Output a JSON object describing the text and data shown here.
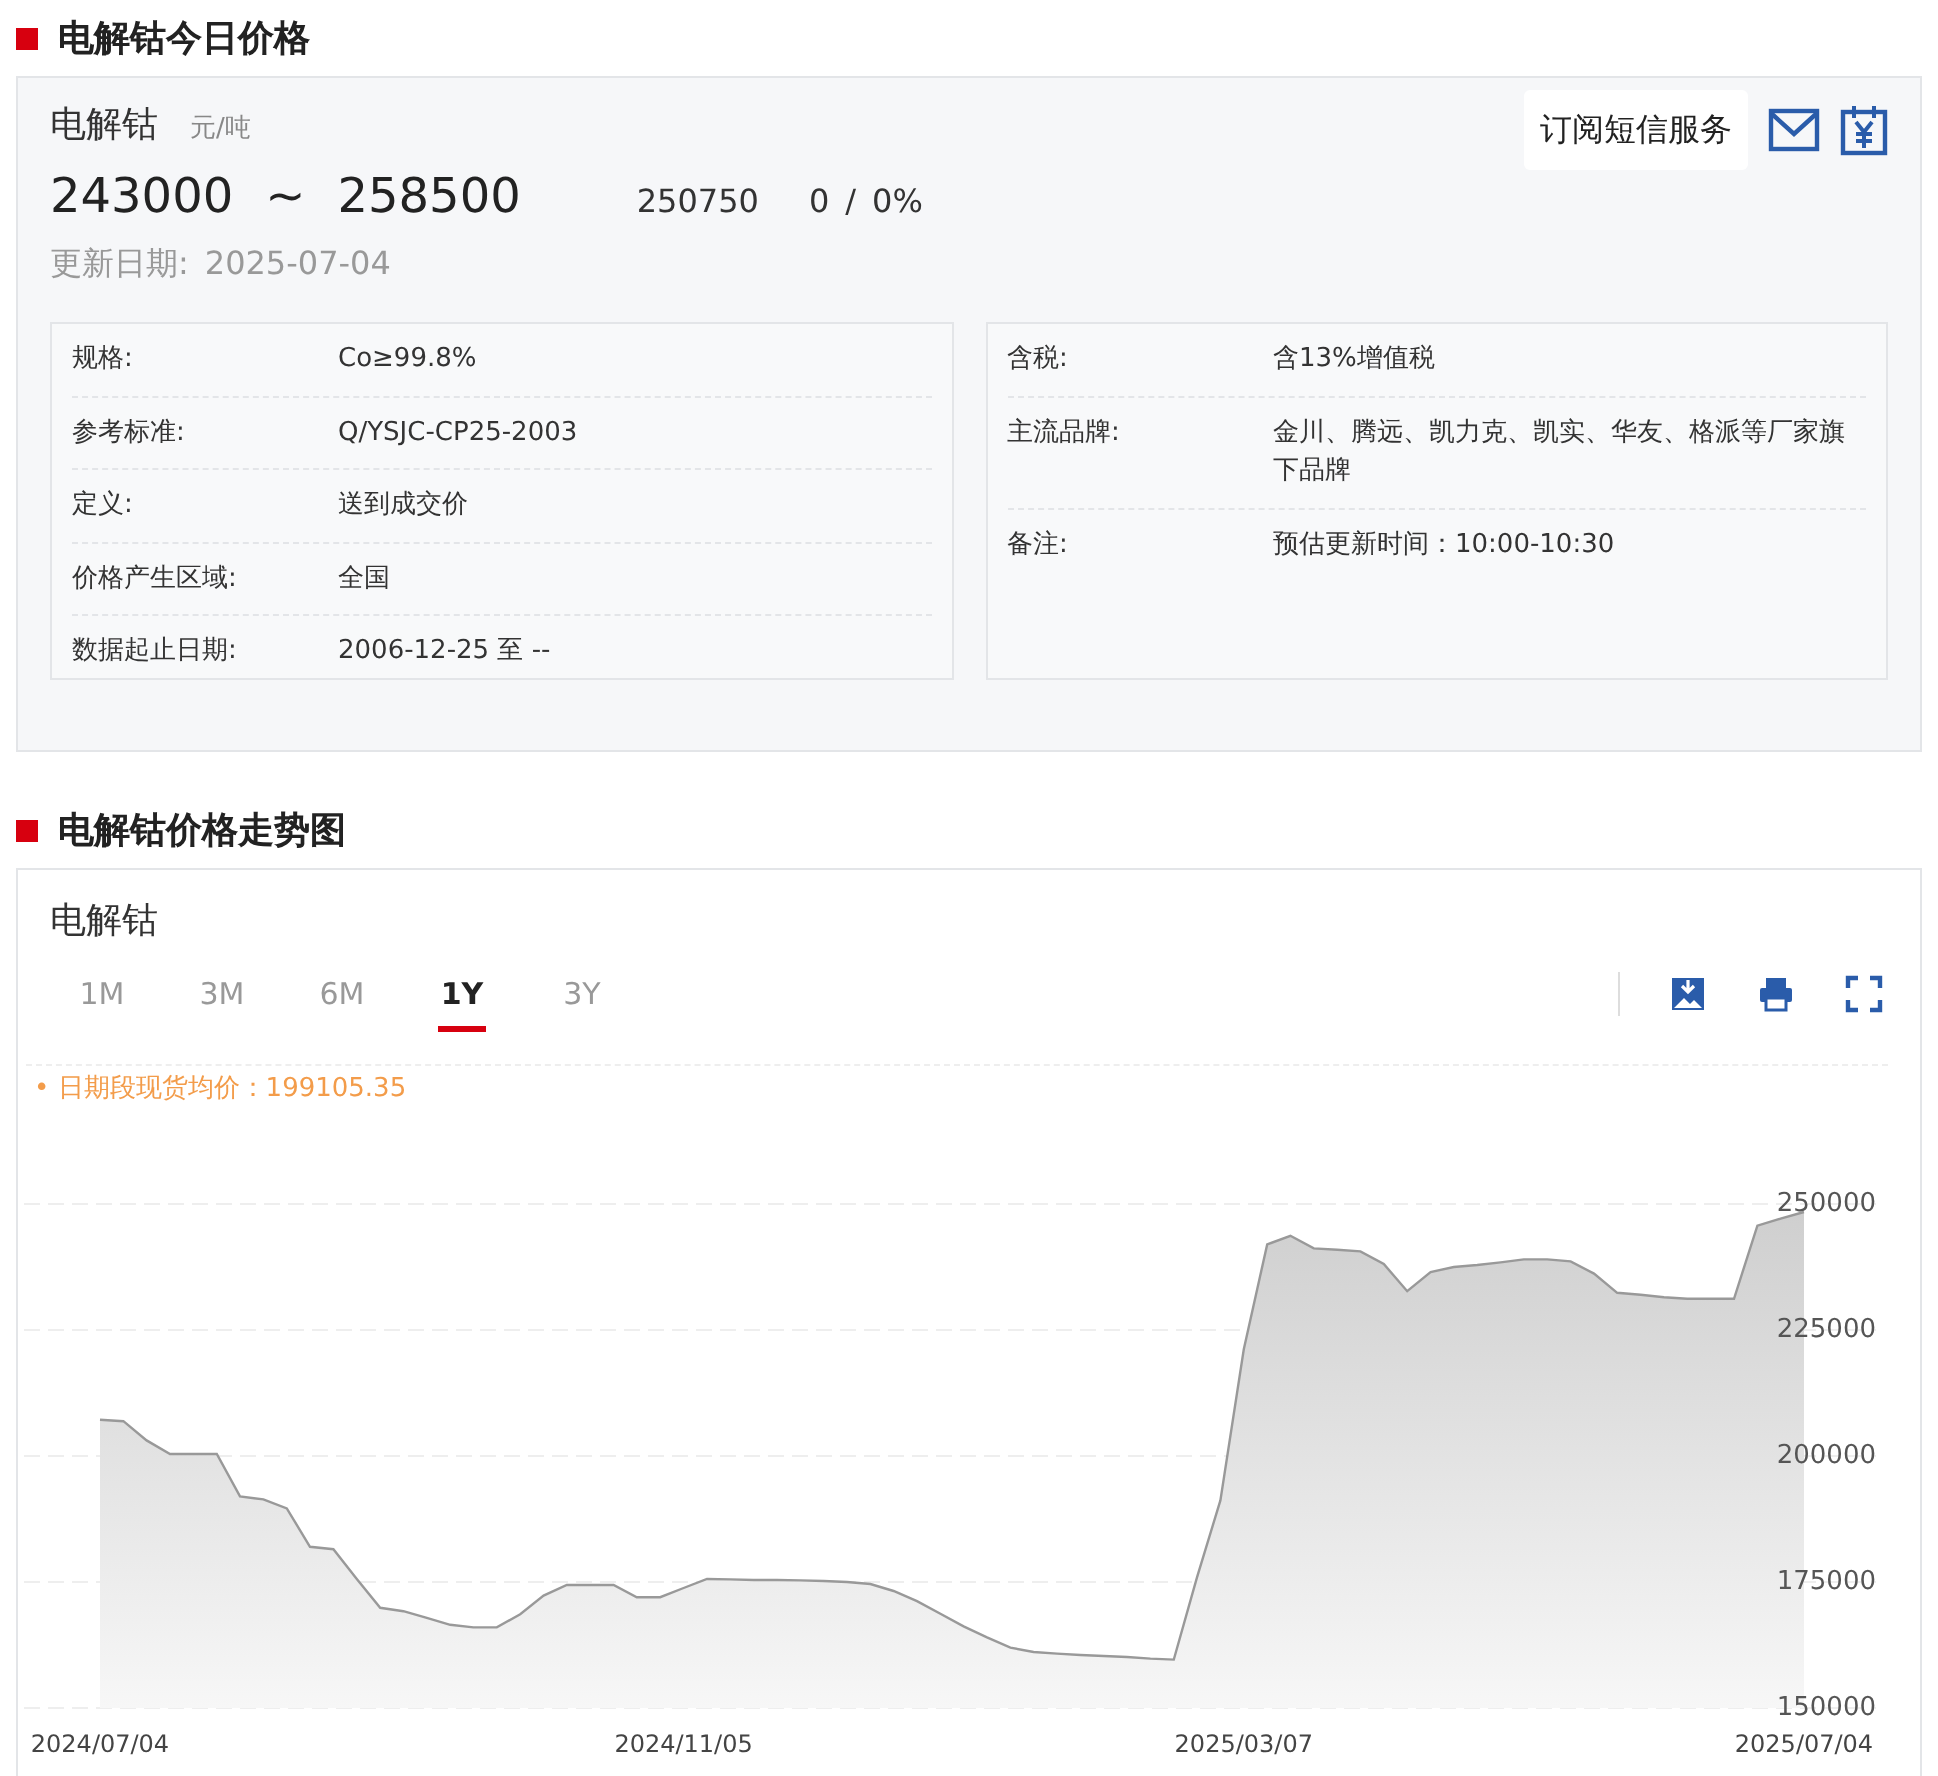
{
  "price_section": {
    "title": "电解钴今日价格",
    "product": {
      "name": "电解钴",
      "unit": "元/吨"
    },
    "price_low": "243000",
    "separator": "~",
    "price_high": "258500",
    "average": "250750",
    "change": "0",
    "slash": "/",
    "change_percent": "0%",
    "update_label": "更新日期:",
    "update_date": "2025-07-04",
    "subscribe": {
      "label": "订阅短信服务"
    },
    "specs_left": [
      {
        "label": "规格:",
        "value": "Co≥99.8%"
      },
      {
        "label": "参考标准:",
        "value": "Q/YSJC-CP25-2003"
      },
      {
        "label": "定义:",
        "value": "送到成交价"
      },
      {
        "label": "价格产生区域:",
        "value": "全国"
      },
      {
        "label": "数据起止日期:",
        "value": "2006-12-25 至 --"
      }
    ],
    "specs_right": [
      {
        "label": "含税:",
        "value": "含13%增值税"
      },
      {
        "label": "主流品牌:",
        "value": "金川、腾远、凯力克、凯实、华友、格派等厂家旗下品牌"
      },
      {
        "label": "备注:",
        "value": "预估更新时间：10:00-10:30"
      }
    ]
  },
  "chart_section": {
    "title": "电解钴价格走势图",
    "card_title": "电解钴",
    "ranges": [
      {
        "label": "1M",
        "selected": false
      },
      {
        "label": "3M",
        "selected": false
      },
      {
        "label": "6M",
        "selected": false
      },
      {
        "label": "1Y",
        "selected": true
      },
      {
        "label": "3Y",
        "selected": false
      }
    ],
    "average_note": "• 日期段现货均价：199105.35",
    "chart_data": {
      "type": "area",
      "categories": [
        "2024/07/04",
        null,
        null,
        null,
        null,
        null,
        null,
        null,
        null,
        null,
        null,
        null,
        null,
        null,
        null,
        null,
        null,
        null,
        null,
        null,
        null,
        null,
        null,
        null,
        null,
        "2024/11/05",
        null,
        null,
        null,
        null,
        null,
        null,
        null,
        null,
        null,
        null,
        null,
        null,
        null,
        null,
        null,
        null,
        null,
        null,
        null,
        null,
        null,
        null,
        null,
        "2025/03/07",
        null,
        null,
        null,
        null,
        null,
        null,
        null,
        null,
        null,
        null,
        null,
        null,
        null,
        null,
        null,
        null,
        null,
        null,
        null,
        null,
        null,
        null,
        null,
        "2025/07/04"
      ],
      "series": [
        {
          "color": "#999999",
          "values": [
            207200,
            206900,
            203100,
            200400,
            200400,
            200400,
            192000,
            191400,
            189600,
            182000,
            181500,
            175600,
            169900,
            169200,
            167900,
            166500,
            166000,
            166000,
            168600,
            172300,
            174400,
            174400,
            174400,
            172000,
            172000,
            173800,
            175600,
            175500,
            175400,
            175400,
            175300,
            175200,
            175000,
            174600,
            173200,
            171200,
            168700,
            166200,
            164000,
            162000,
            161100,
            160800,
            160500,
            160300,
            160100,
            159800,
            159600,
            175900,
            191200,
            221200,
            242000,
            243700,
            241200,
            240900,
            240600,
            238100,
            232700,
            236500,
            237500,
            237900,
            238400,
            239000,
            239000,
            238600,
            236200,
            232400,
            232000,
            231500,
            231200,
            231200,
            231200,
            245700,
            247100,
            248400
          ]
        }
      ],
      "ylim": [
        150000,
        250000
      ],
      "grid": true,
      "yticks": [
        150000,
        175000,
        200000,
        225000,
        250000
      ]
    }
  }
}
